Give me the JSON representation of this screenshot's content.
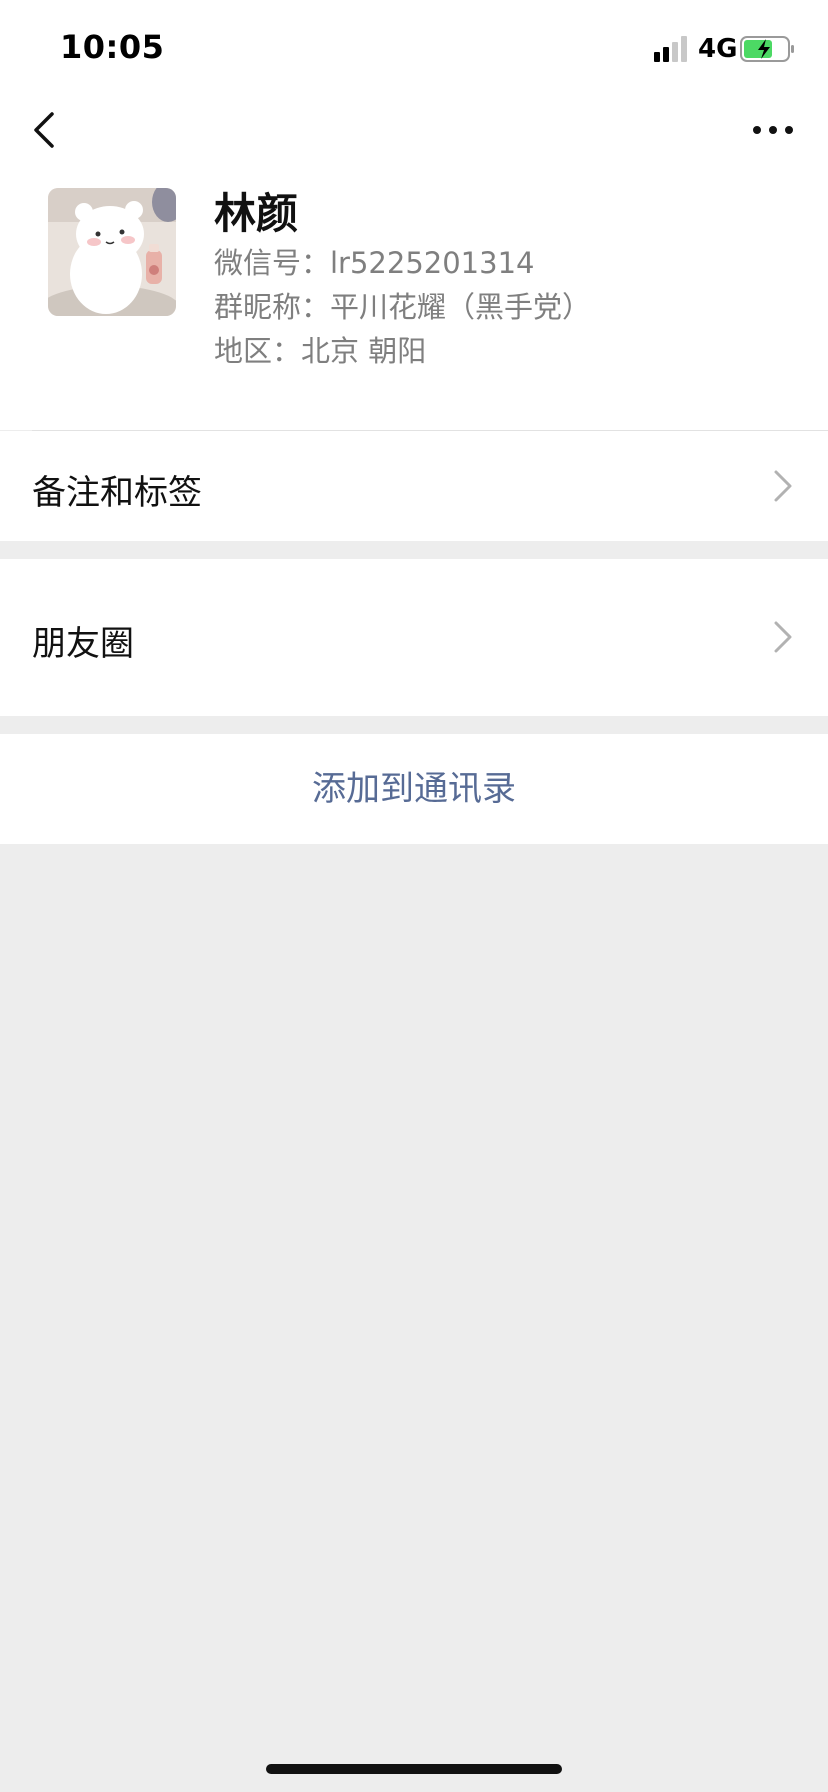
{
  "status_bar": {
    "time": "10:05",
    "network": "4G",
    "signal_icon": "cellular-signal-icon",
    "battery_icon": "battery-charging-icon",
    "battery_color": "#4cd964"
  },
  "nav": {
    "back_icon": "chevron-left-icon",
    "more_icon": "more-dots-icon"
  },
  "profile": {
    "name": "林颜",
    "wechat_id_line": "微信号：lr5225201314",
    "group_nickname_line": "群昵称：平川花耀（黑手党）",
    "region_line": "地区：北京 朝阳"
  },
  "cells": {
    "remark_label": "备注和标签",
    "moments_label": "朋友圈"
  },
  "actions": {
    "add_contact_label": "添加到通讯录",
    "link_color": "#576b95"
  }
}
